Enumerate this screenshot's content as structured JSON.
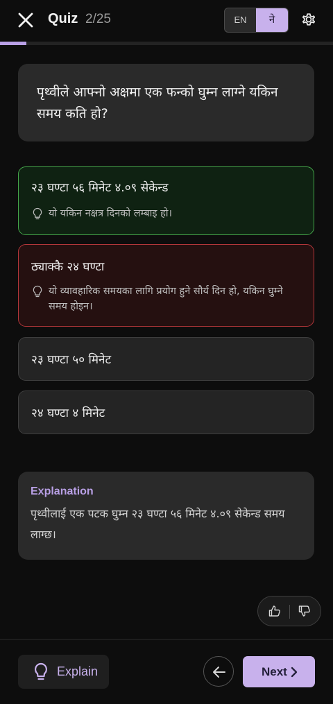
{
  "header": {
    "close_icon": "close-icon",
    "title": "Quiz",
    "counter": "2/25",
    "language_options": [
      "EN",
      "ने"
    ],
    "selected_language": "ने",
    "settings_icon": "gear-icon"
  },
  "progress": {
    "current": 2,
    "total": 25,
    "fraction": 0.08
  },
  "question": {
    "text": "पृथ्वीले आफ्नो अक्षमा एक फन्को घुम्न लाग्ने यकिन समय कति हो?"
  },
  "options": [
    {
      "text": "२३ घण्टा ५६ मिनेट ४.०९ सेकेन्ड",
      "state": "correct",
      "hint": "यो यकिन नक्षत्र दिनको लम्बाइ हो।"
    },
    {
      "text": "ठ्याक्कै २४ घण्टा",
      "state": "wrong",
      "hint": "यो व्यावहारिक समयका लागि प्रयोग हुने सौर्य दिन हो, यकिन घुम्ने समय होइन।"
    },
    {
      "text": "२३ घण्टा ५० मिनेट",
      "state": "neutral"
    },
    {
      "text": "२४ घण्टा ४ मिनेट",
      "state": "neutral"
    }
  ],
  "explanation": {
    "title": "Explanation",
    "text": "पृथ्वीलाई एक पटक घुम्न २३ घण्टा ५६ मिनेट ४.०९ सेकेन्ड समय लाग्छ।"
  },
  "feedback": {
    "like_icon": "thumbs-up-icon",
    "dislike_icon": "thumbs-down-icon"
  },
  "footer": {
    "explain_label": "Explain",
    "explain_icon": "lightbulb-icon",
    "back_icon": "arrow-left-icon",
    "next_label": "Next",
    "next_icon": "chevron-right-icon"
  },
  "colors": {
    "accent": "#c8b1ec",
    "correct_border": "#45a64a",
    "wrong_border": "#b3363a",
    "background": "#0d0d0d",
    "card": "#2a2a2a"
  }
}
